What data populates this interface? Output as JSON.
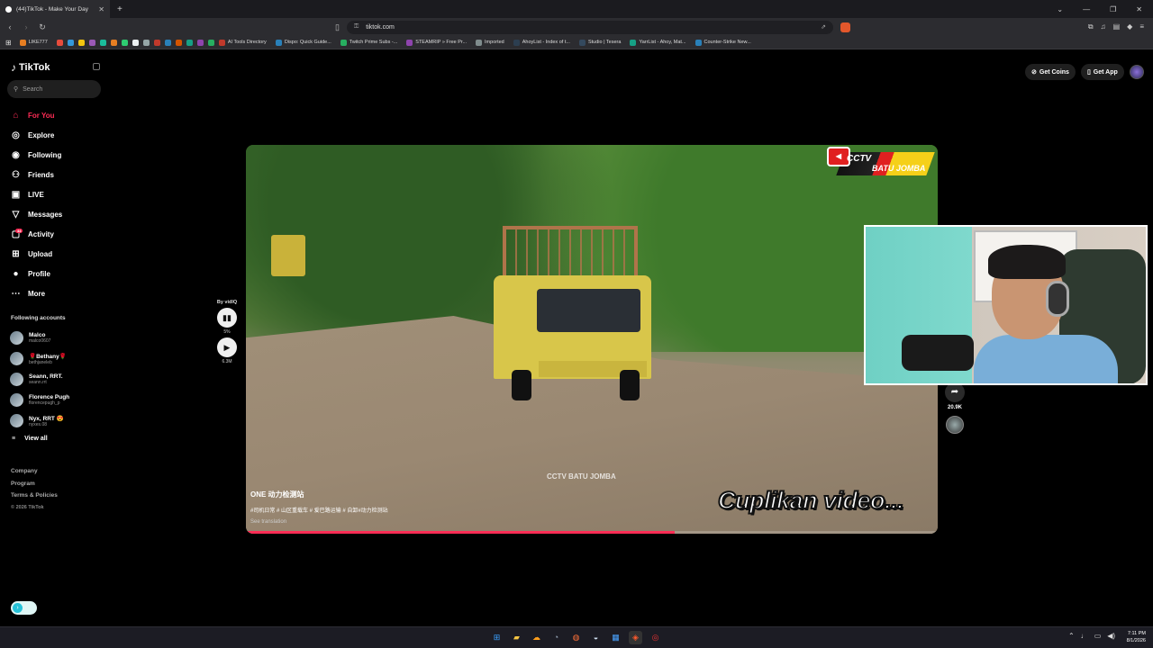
{
  "browser": {
    "tab_title": "(44)TikTok - Make Your Day",
    "url": "tiktok.com",
    "bookmarks": [
      {
        "label": "LIKE777",
        "color": "#e67e22"
      },
      {
        "label": "AI Tools Directory",
        "color": "#c0392b"
      },
      {
        "label": "Dispo: Quick Guide...",
        "color": "#2980b9"
      },
      {
        "label": "Twitch Prime Subs -...",
        "color": "#27ae60"
      },
      {
        "label": "STEAMRIP » Free Pr...",
        "color": "#8e44ad"
      },
      {
        "label": "Imported",
        "color": "#7f8c8d"
      },
      {
        "label": "AhoyList - Index of t...",
        "color": "#2c3e50"
      },
      {
        "label": "Studio | Tesera",
        "color": "#34495e"
      },
      {
        "label": "YarrList - Ahoy, Mat...",
        "color": "#16a085"
      },
      {
        "label": "Counter-Strike New...",
        "color": "#2980b9"
      }
    ]
  },
  "sidebar": {
    "logo": "TikTok",
    "search_placeholder": "Search",
    "menu": [
      {
        "label": "For You",
        "icon": "home-icon",
        "glyph": "⌂",
        "active": true
      },
      {
        "label": "Explore",
        "icon": "compass-icon",
        "glyph": "◎"
      },
      {
        "label": "Following",
        "icon": "following-icon",
        "glyph": "◉"
      },
      {
        "label": "Friends",
        "icon": "friends-icon",
        "glyph": "⚇"
      },
      {
        "label": "LIVE",
        "icon": "live-icon",
        "glyph": "▣"
      },
      {
        "label": "Messages",
        "icon": "messages-icon",
        "glyph": "▽"
      },
      {
        "label": "Activity",
        "icon": "activity-icon",
        "glyph": "▢",
        "badge": "44"
      },
      {
        "label": "Upload",
        "icon": "upload-icon",
        "glyph": "⊞"
      },
      {
        "label": "Profile",
        "icon": "profile-icon",
        "glyph": "●"
      },
      {
        "label": "More",
        "icon": "more-icon",
        "glyph": "⋯"
      }
    ],
    "following_title": "Following accounts",
    "accounts": [
      {
        "name": "Malco",
        "handle": "malco0607"
      },
      {
        "name": "🌹Bethany🌹",
        "handle": "bethjaneleb"
      },
      {
        "name": "Seann, RRT.",
        "handle": "seann.rrt"
      },
      {
        "name": "Florence Pugh",
        "handle": "florencepugh_p"
      },
      {
        "name": "Nyx, RRT 😍",
        "handle": "nyxes.08"
      }
    ],
    "view_all": "View all",
    "footer": {
      "company": "Company",
      "program": "Program",
      "terms": "Terms & Policies",
      "copyright": "© 2026 TikTok"
    }
  },
  "header": {
    "get_coins": "Get Coins",
    "get_app": "Get App"
  },
  "video": {
    "watermark_line1": "CCTV",
    "watermark_line2": "BATU JOMBA",
    "center_watermark": "CCTV BATU JOMBA",
    "overlay_text": "Cuplikan video...",
    "author": "ONE 动力检测站",
    "tags": "#司机日常 # 山区重载车 # 爱巴路运输 # 自卸#动力检测站",
    "see_translation": "See translation",
    "progress": 0.62
  },
  "vidiq": {
    "by": "By vidIQ",
    "pct": "5%",
    "views": "6.3M"
  },
  "actions": {
    "share_count": "20.9K"
  },
  "taskbar": {
    "time": "7:11 PM",
    "date": "8/1/2026"
  }
}
